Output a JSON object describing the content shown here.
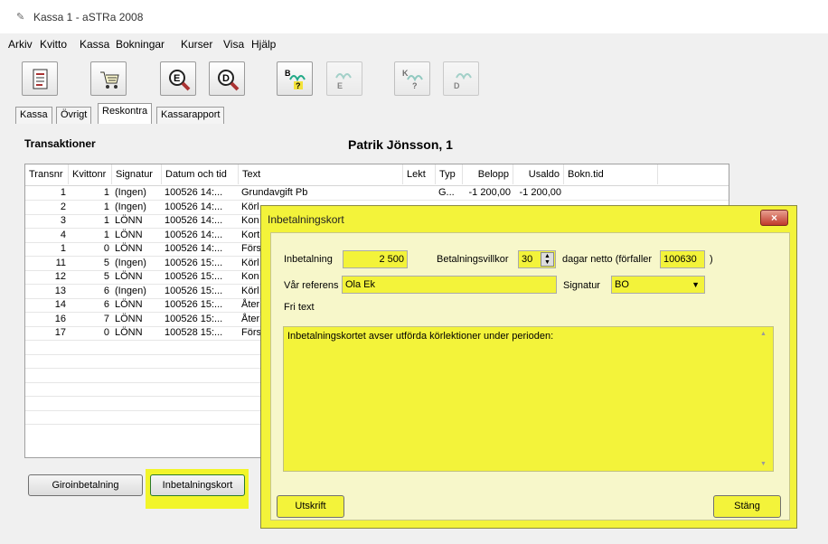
{
  "window": {
    "title": "Kassa 1 - aSTRa 2008"
  },
  "menu": [
    "Arkiv",
    "Kvitto",
    "Kassa",
    "Bokningar",
    "Kurser",
    "Visa",
    "Hjälp"
  ],
  "toolbar": {
    "buttons": [
      {
        "icon": "receipt-icon",
        "enabled": true
      },
      {
        "icon": "cart-icon",
        "enabled": true
      },
      {
        "icon": "magnifier-e-icon",
        "letter": "E",
        "enabled": true
      },
      {
        "icon": "magnifier-d-icon",
        "letter": "D",
        "enabled": true
      },
      {
        "icon": "booking-b-icon",
        "letter": "B",
        "enabled": true
      },
      {
        "icon": "booking-e-icon",
        "letter": "E",
        "enabled": false
      },
      {
        "icon": "course-k-icon",
        "letter": "K",
        "enabled": false
      },
      {
        "icon": "booking-d-icon",
        "letter": "D",
        "enabled": false
      }
    ]
  },
  "tabs": [
    {
      "label": "Kassa",
      "active": false
    },
    {
      "label": "Övrigt",
      "active": false
    },
    {
      "label": "Reskontra",
      "active": true
    },
    {
      "label": "Kassarapport",
      "active": false
    }
  ],
  "section_title": "Transaktioner",
  "person": "Patrik Jönsson, 1",
  "table": {
    "headers": [
      "Transnr",
      "Kvittonr",
      "Signatur",
      "Datum och tid",
      "Text",
      "Lekt",
      "Typ",
      "Belopp",
      "Usaldo",
      "Bokn.tid"
    ],
    "rows": [
      [
        "1",
        "1",
        "(Ingen)",
        "100526 14:...",
        "Grundavgift Pb",
        "",
        "G...",
        "-1 200,00",
        "-1 200,00",
        ""
      ],
      [
        "2",
        "1",
        "(Ingen)",
        "100526 14:...",
        "Körl",
        "",
        "",
        "",
        "",
        ""
      ],
      [
        "3",
        "1",
        "LÖNN",
        "100526 14:...",
        "Kon",
        "",
        "",
        "",
        "",
        ""
      ],
      [
        "4",
        "1",
        "LÖNN",
        "100526 14:...",
        "Kort",
        "",
        "",
        "",
        "",
        ""
      ],
      [
        "1",
        "0",
        "LÖNN",
        "100526 14:...",
        "Förs",
        "",
        "",
        "",
        "",
        ""
      ],
      [
        "11",
        "5",
        "(Ingen)",
        "100526 15:...",
        "Körl",
        "",
        "",
        "",
        "",
        ""
      ],
      [
        "12",
        "5",
        "LÖNN",
        "100526 15:...",
        "Kon",
        "",
        "",
        "",
        "",
        ""
      ],
      [
        "13",
        "6",
        "(Ingen)",
        "100526 15:...",
        "Körl",
        "",
        "",
        "",
        "",
        ""
      ],
      [
        "14",
        "6",
        "LÖNN",
        "100526 15:...",
        "Åter",
        "",
        "",
        "",
        "",
        ""
      ],
      [
        "16",
        "7",
        "LÖNN",
        "100526 15:...",
        "Åter",
        "",
        "",
        "",
        "",
        ""
      ],
      [
        "17",
        "0",
        "LÖNN",
        "100528 15:...",
        "Förs",
        "",
        "",
        "",
        "",
        ""
      ]
    ]
  },
  "buttons": {
    "giro": "Giroinbetalning",
    "inbetalningskort": "Inbetalningskort"
  },
  "dialog": {
    "title": "Inbetalningskort",
    "close": "×",
    "inbetalning_label": "Inbetalning",
    "inbetalning_value": "2 500",
    "villkor_label": "Betalningsvillkor",
    "villkor_value": "30",
    "dagar_label": "dagar netto (förfaller",
    "forfaller_value": "100630",
    "close_paren": ")",
    "referens_label": "Vår referens",
    "referens_value": "Ola Ek",
    "signatur_label": "Signatur",
    "signatur_value": "BO",
    "fritext_label": "Fri text",
    "fritext_value": "Inbetalningskortet avser utförda körlektioner under perioden:",
    "utskrift": "Utskrift",
    "stang": "Stäng"
  },
  "colors": {
    "highlight": "#f3f33a",
    "close_button": "#c0392b"
  }
}
